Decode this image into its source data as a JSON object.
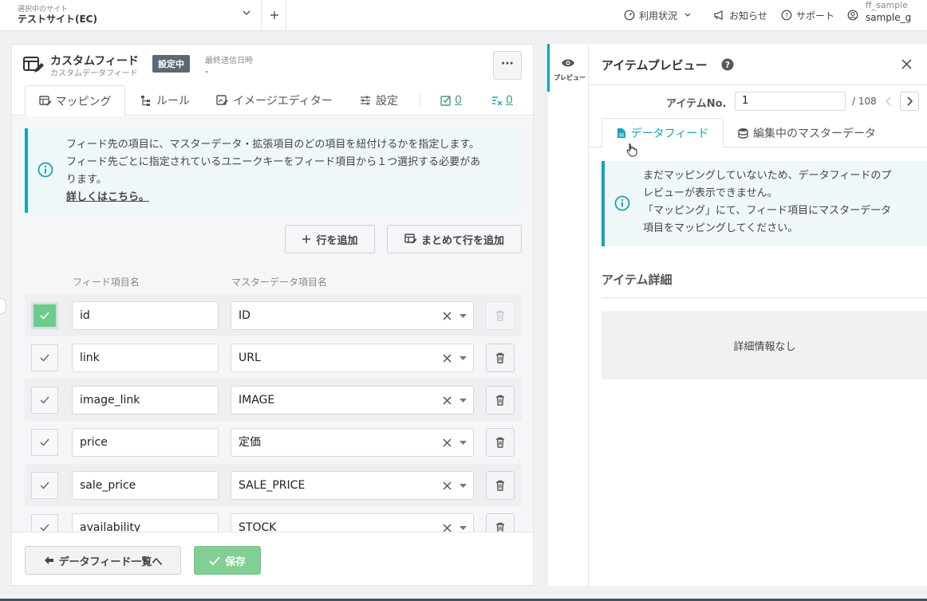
{
  "topbar": {
    "site_label": "選択中のサイト",
    "site_name": "テストサイト(EC)",
    "nav": {
      "usage": "利用状況",
      "notice": "お知らせ",
      "support": "サポート"
    },
    "user_id": "ff_sample",
    "user_name": "sample_g"
  },
  "feed": {
    "title": "カスタムフィード",
    "subtitle": "カスタムデータフィード",
    "badge": "設定中",
    "last_sent_label": "最終送信日時",
    "last_sent_value": "-",
    "more_label": "···"
  },
  "tabs": {
    "mapping": "マッピング",
    "rules": "ルール",
    "image_editor": "イメージエディター",
    "settings": "設定",
    "ok_count": "0",
    "err_count": "0"
  },
  "info": {
    "line1": "フィード先の項目に、マスターデータ・拡張項目のどの項目を紐付けるかを指定します。",
    "line2": "フィード先ごとに指定されているユニークキーをフィード項目から１つ選択する必要があ",
    "line3": "ります。",
    "link": "詳しくはこちら。"
  },
  "actions": {
    "add_row": "行を追加",
    "bulk_add": "まとめて行を追加"
  },
  "columns": {
    "feed_item": "フィード項目名",
    "master_item": "マスターデータ項目名"
  },
  "rows": [
    {
      "feed": "id",
      "master": "ID"
    },
    {
      "feed": "link",
      "master": "URL"
    },
    {
      "feed": "image_link",
      "master": "IMAGE"
    },
    {
      "feed": "price",
      "master": "定価"
    },
    {
      "feed": "sale_price",
      "master": "SALE_PRICE"
    },
    {
      "feed": "availability",
      "master": "STOCK"
    }
  ],
  "footer": {
    "back": "データフィード一覧へ",
    "save": "保存"
  },
  "preview": {
    "strip_label": "プレビュー",
    "title": "アイテムプレビュー",
    "item_label": "アイテムNo.",
    "item_value": "1",
    "item_total": "/ 108",
    "tab_feed": "データフィード",
    "tab_master": "編集中のマスターデータ",
    "info_line1": "まだマッピングしていないため、データフィードのプ",
    "info_line2": "レビューが表示できません。",
    "info_line3": "「マッピング」にて、フィード項目にマスターデータ",
    "info_line4": "項目をマッピングしてください。",
    "detail_title": "アイテム詳細",
    "detail_empty": "詳細情報なし"
  },
  "colors": {
    "accent": "#14a5b8",
    "success": "#6dcc8a",
    "badge": "#5b6970"
  }
}
